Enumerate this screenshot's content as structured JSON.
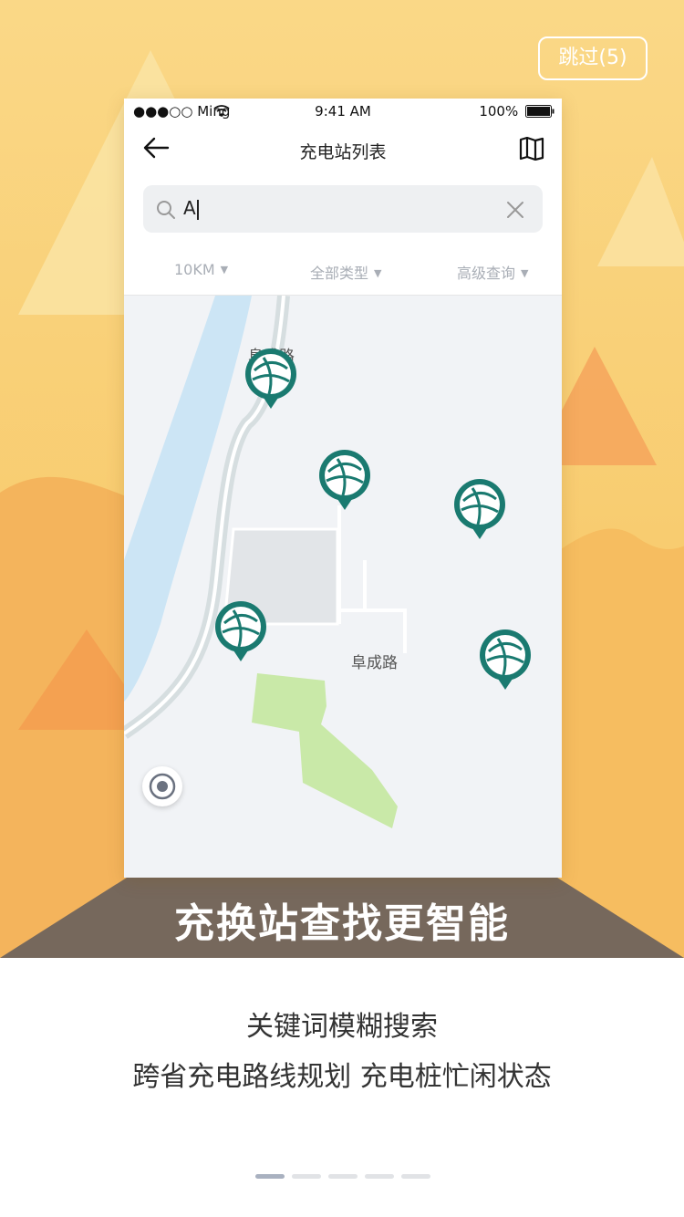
{
  "skip_label": "跳过(5)",
  "status_bar": {
    "carrier": "●●●○○ Ming",
    "time": "9:41 AM",
    "battery": "100%"
  },
  "nav": {
    "title": "充电站列表"
  },
  "search": {
    "value": "A"
  },
  "filters": [
    {
      "label": "10KM"
    },
    {
      "label": "全部类型"
    },
    {
      "label": "高级查询"
    }
  ],
  "map": {
    "road_labels": [
      "阜成路",
      "阜成路"
    ],
    "pin_count": 5
  },
  "banner": {
    "headline": "充换站查找更智能"
  },
  "description": {
    "line1": "关键词模糊搜索",
    "line2": "跨省充电路线规划   充电桩忙闲状态"
  },
  "pagination": {
    "total": 5,
    "active": 1
  },
  "colors": {
    "accent": "#1a7a70",
    "banner_bg": "#76685c",
    "bg_yellow": "#f8d27e",
    "skip_border": "#ffffff",
    "park": "#c9e9a8",
    "river": "#cce5f5"
  }
}
